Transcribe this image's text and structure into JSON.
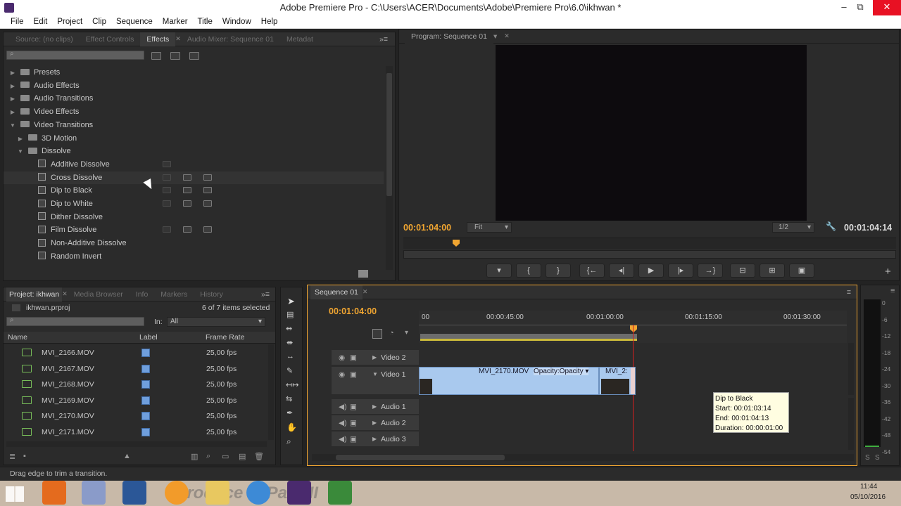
{
  "window": {
    "title": "Adobe Premiere Pro - C:\\Users\\ACER\\Documents\\Adobe\\Premiere Pro\\6.0\\ikhwan *",
    "minimize": "–",
    "maximize": "⧉",
    "close": "✕"
  },
  "menu": [
    "File",
    "Edit",
    "Project",
    "Clip",
    "Sequence",
    "Marker",
    "Title",
    "Window",
    "Help"
  ],
  "source_panel": {
    "tabs": [
      "Source: (no clips)",
      "Effect Controls",
      "Effects",
      "Audio Mixer: Sequence 01",
      "Metadat"
    ],
    "active_tab": "Effects",
    "tree": [
      {
        "label": "Presets",
        "level": 0,
        "kind": "folder",
        "expanded": false
      },
      {
        "label": "Audio Effects",
        "level": 0,
        "kind": "folder",
        "expanded": false
      },
      {
        "label": "Audio Transitions",
        "level": 0,
        "kind": "folder",
        "expanded": false
      },
      {
        "label": "Video Effects",
        "level": 0,
        "kind": "folder",
        "expanded": false
      },
      {
        "label": "Video Transitions",
        "level": 0,
        "kind": "folder",
        "expanded": true
      },
      {
        "label": "3D Motion",
        "level": 1,
        "kind": "folder",
        "expanded": false
      },
      {
        "label": "Dissolve",
        "level": 1,
        "kind": "folder",
        "expanded": true
      },
      {
        "label": "Additive Dissolve",
        "level": 2,
        "kind": "effect",
        "badges": 1
      },
      {
        "label": "Cross Dissolve",
        "level": 2,
        "kind": "effect",
        "badges": 3
      },
      {
        "label": "Dip to Black",
        "level": 2,
        "kind": "effect",
        "badges": 3
      },
      {
        "label": "Dip to White",
        "level": 2,
        "kind": "effect",
        "badges": 3
      },
      {
        "label": "Dither Dissolve",
        "level": 2,
        "kind": "effect",
        "badges": 0
      },
      {
        "label": "Film Dissolve",
        "level": 2,
        "kind": "effect",
        "badges": 3
      },
      {
        "label": "Non-Additive Dissolve",
        "level": 2,
        "kind": "effect",
        "badges": 0
      },
      {
        "label": "Random Invert",
        "level": 2,
        "kind": "effect",
        "badges": 0
      }
    ]
  },
  "program": {
    "tab": "Program: Sequence 01",
    "current_tc": "00:01:04:00",
    "fit": "Fit",
    "resolution": "1/2",
    "duration_tc": "00:01:04:14"
  },
  "project": {
    "tabs": [
      "Project: ikhwan",
      "Media Browser",
      "Info",
      "Markers",
      "History"
    ],
    "file": "ikhwan.prproj",
    "selection": "6 of 7 items selected",
    "in_label": "In:",
    "in_value": "All",
    "columns": [
      "Name",
      "Label",
      "Frame Rate"
    ],
    "rows": [
      {
        "name": "MVI_2166.MOV",
        "fps": "25,00 fps"
      },
      {
        "name": "MVI_2167.MOV",
        "fps": "25,00 fps"
      },
      {
        "name": "MVI_2168.MOV",
        "fps": "25,00 fps"
      },
      {
        "name": "MVI_2169.MOV",
        "fps": "25,00 fps"
      },
      {
        "name": "MVI_2170.MOV",
        "fps": "25,00 fps"
      },
      {
        "name": "MVI_2171.MOV",
        "fps": "25,00 fps"
      }
    ]
  },
  "timeline": {
    "tab": "Sequence 01",
    "current_tc": "00:01:04:00",
    "ruler": [
      "00",
      "00:00:45:00",
      "00:01:00:00",
      "00:01:15:00",
      "00:01:30:00"
    ],
    "tracks": [
      "Video 2",
      "Video 1",
      "Audio 1",
      "Audio 2",
      "Audio 3"
    ],
    "clip1": "MVI_2170.MOV",
    "clip1_fx": "Opacity:Opacity ▾",
    "clip2": "MVI_2:",
    "tooltip": [
      "Dip to Black",
      "Start: 00:01:03:14",
      "End: 00:01:04:13",
      "Duration: 00:00:01:00"
    ]
  },
  "meter": {
    "ticks": [
      "0",
      "-6",
      "-12",
      "-18",
      "-24",
      "-30",
      "-36",
      "-42",
      "-48",
      "-54"
    ],
    "solo": "S"
  },
  "status": "Drag edge to trim a transition.",
  "taskbar": {
    "overlay": "Introduce ... Part III",
    "time": "11:44",
    "date": "05/10/2016"
  },
  "colors": {
    "accent": "#f0a531",
    "clip": "#a9c9ee",
    "panel": "#2b2b2b"
  }
}
